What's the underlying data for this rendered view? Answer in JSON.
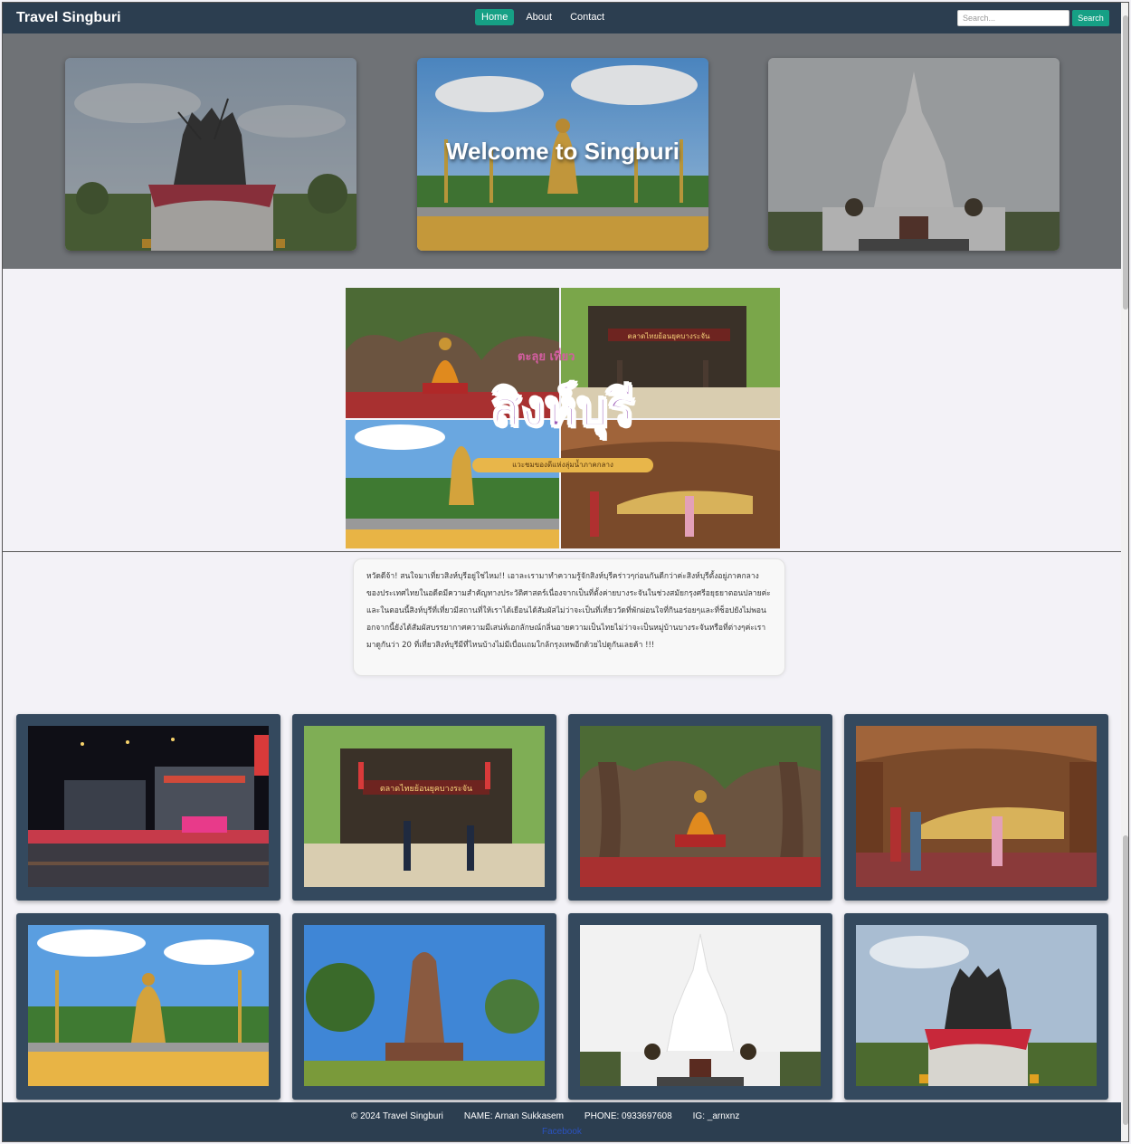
{
  "nav": {
    "brand": "Travel Singburi",
    "links": [
      "Home",
      "About",
      "Contact"
    ],
    "active": "Home",
    "search_placeholder": "Search...",
    "search_button": "Search"
  },
  "hero": {
    "title": "Welcome to Singburi"
  },
  "collage": {
    "logo": "สิงห์บุรี",
    "tag": "ตะลุย เที่ยว",
    "subtitle": "แวะชมของดีแห่งลุ่มน้ำภาคกลาง",
    "sign": "ตลาดไทยย้อนยุคบางระจัน"
  },
  "intro": {
    "text": "หวัดดีจ้า! สนใจมาเที่ยวสิงห์บุรีอยู่ใช่ไหม!! เอาละเรามาทำความรู้จักสิงห์บุรีคร่าวๆก่อนกันดีกว่าค่ะสิงห์บุรีตั้งอยู่ภาคกลางของประเทศไทยในอดีตมีความสำคัญทางประวัติศาสตร์เนื่องจากเป็นที่ตั้งค่ายบางระจันในช่วงสมัยกรุงศรีอยุธยาตอนปลายค่ะและในตอนนี้สิงห์บุรีที่เที่ยวมีสถานที่ให้เราได้เยือนได้สัมผัสไม่ว่าจะเป็นที่เที่ยววัดที่พักผ่อนใจที่กินอร่อยๆและที่ช็อปยังไม่พอนอกจากนี้ยังได้สัมผัสบรรยากาศความมีเสน่ห์เอกลักษณ์กลิ่นอายความเป็นไทยไม่ว่าจะเป็นหมู่บ้านบางระจันหรือที่ต่างๆค่ะเรามาดูกันว่า 20 ที่เที่ยวสิงห์บุรีมีที่ไหนบ้างไม่มีเบื่อแถมใกล้กรุงเทพอีกด้วยไปดูกันเลยค้า !!!"
  },
  "gallery": [
    {
      "name": "night-market"
    },
    {
      "name": "bang-rachan-gate"
    },
    {
      "name": "buddha-under-tree"
    },
    {
      "name": "reclining-buddha"
    },
    {
      "name": "big-buddha-park"
    },
    {
      "name": "ruined-prang"
    },
    {
      "name": "white-pagoda"
    },
    {
      "name": "heroes-monument"
    }
  ],
  "footer": {
    "copyright": "© 2024 Travel Singburi",
    "name": "NAME: Arnan Sukkasem",
    "phone": "PHONE: 0933697608",
    "ig": "IG: _arnxnz",
    "link": "Facebook"
  },
  "colors": {
    "nav_bg": "#2c3e50",
    "accent": "#16a085",
    "card_bg": "#34495e",
    "page_bg": "#f3f2f7"
  }
}
